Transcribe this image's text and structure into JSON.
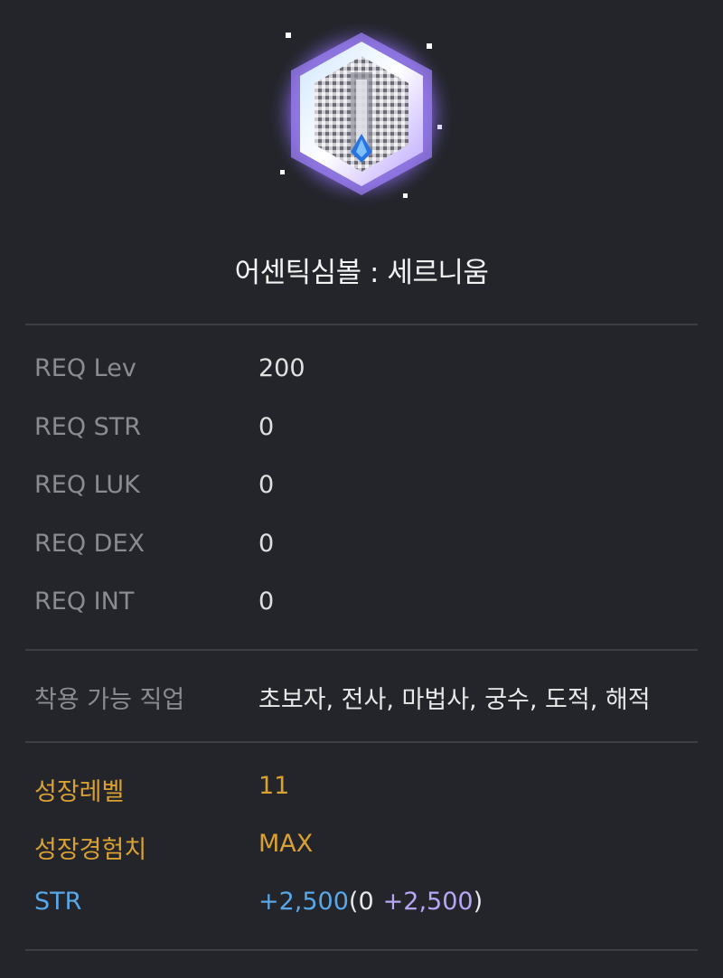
{
  "item": {
    "name": "어센틱심볼 : 세르니움",
    "icon": "authentic-symbol-cernium-icon"
  },
  "requirements": [
    {
      "label": "REQ Lev",
      "value": "200"
    },
    {
      "label": "REQ STR",
      "value": "0"
    },
    {
      "label": "REQ LUK",
      "value": "0"
    },
    {
      "label": "REQ DEX",
      "value": "0"
    },
    {
      "label": "REQ INT",
      "value": "0"
    }
  ],
  "job": {
    "label": "착용 가능 직업",
    "value": "초보자, 전사, 마법사, 궁수, 도적, 해적"
  },
  "growth": {
    "level_label": "성장레벨",
    "level_value": "11",
    "exp_label": "성장경험치",
    "exp_value": "MAX"
  },
  "stat": {
    "label": "STR",
    "total": "+2,500",
    "open_paren": "(",
    "base": "0",
    "bonus": "+2,500",
    "close_paren": ")"
  },
  "colors": {
    "background": "#23252b",
    "gold": "#d9a133",
    "blue": "#5aa7e8",
    "purple": "#b7a6f5",
    "label_gray": "#8a8c92"
  }
}
